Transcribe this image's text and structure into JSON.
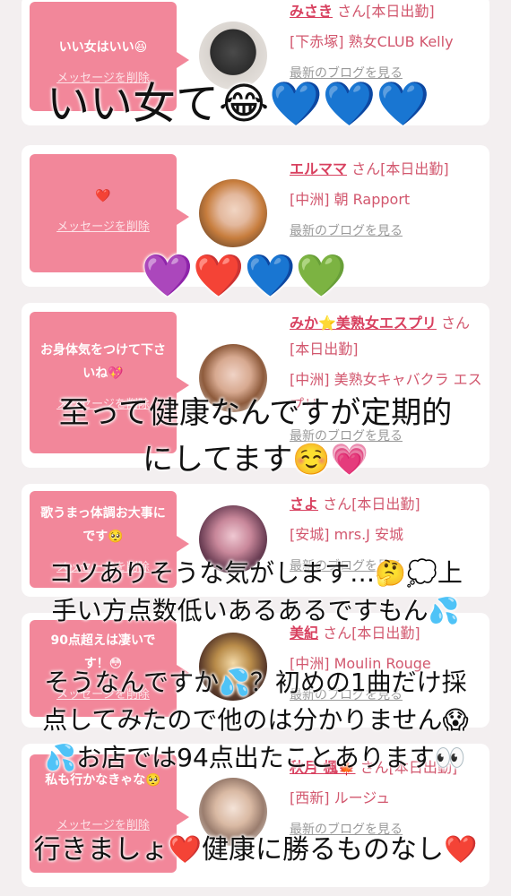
{
  "cards": [
    {
      "message": "いい女はいい😆",
      "delete_label": "メッセージを削除",
      "name": "みさき",
      "suffix": "さん[本日出勤]",
      "shop": "[下赤塚] 熟女CLUB Kelly",
      "blog_label": "最新のブログを見る"
    },
    {
      "message": "❤️",
      "delete_label": "メッセージを削除",
      "name": "エルママ",
      "suffix": "さん[本日出勤]",
      "shop": "[中洲] 朝 Rapport",
      "blog_label": "最新のブログを見る"
    },
    {
      "message": "お身体気をつけて下さいね💖",
      "delete_label": "メッセージを削除",
      "name": "みか⭐️美熟女エスプリ",
      "suffix": "さん[本日出勤]",
      "shop": "[中洲] 美熟女キャバクラ エスプリ",
      "blog_label": "最新のブログを見る"
    },
    {
      "message": "歌うまっ体調お大事にです🥺",
      "delete_label": "メッセージを削除",
      "name": "さよ",
      "suffix": "さん[本日出勤]",
      "shop": "[安城] mrs.J 安城",
      "blog_label": "最新のブログを見る"
    },
    {
      "message": "90点超えは凄いです！😳",
      "delete_label": "メッセージを削除",
      "name": "美紀",
      "suffix": "さん[本日出勤]",
      "shop": "[中洲] Moulin Rouge",
      "blog_label": "最新のブログを見る"
    },
    {
      "message": "私も行かなきゃな🥺",
      "delete_label": "メッセージを削除",
      "name": "秋月 楓🍁",
      "suffix": "さん[本日出勤]",
      "shop": "[西新] ルージュ",
      "blog_label": "最新のブログを見る"
    }
  ],
  "captions": {
    "c1": "いい女て😂💙💙💙",
    "c2": "💜❤️💙💚",
    "c3a": "至って健康なんですが定期的",
    "c3b": "にしてます☺️💗",
    "c4a": "コツありそうな気がします…🤔💭上",
    "c4b": "手い方点数低いあるあるですもん💦",
    "c5a": "そうなんですか💦？初めの1曲だけ採",
    "c5b": "点してみたので他のは分かりません😱",
    "c5c": "💦お店では94点出たことあります👀",
    "c6": "行きましょ❤️健康に勝るものなし❤️"
  },
  "colors": {
    "bubble": "#f2879a",
    "name": "#d8405f",
    "shop": "#d2576e",
    "blog": "#9a9a9a",
    "background": "#f3eff0"
  }
}
